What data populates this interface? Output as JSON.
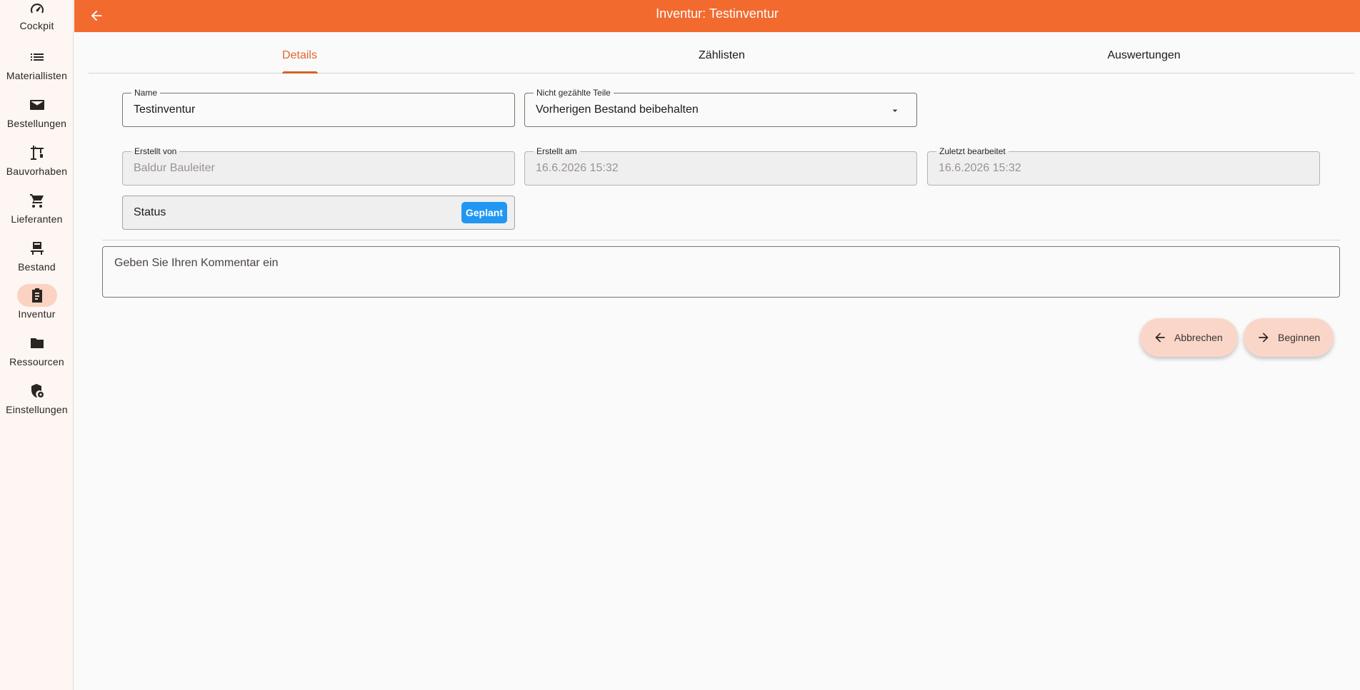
{
  "sidebar": {
    "items": [
      {
        "label": "Cockpit",
        "icon": "speedometer-icon"
      },
      {
        "label": "Materiallisten",
        "icon": "list-icon"
      },
      {
        "label": "Bestellungen",
        "icon": "mail-icon"
      },
      {
        "label": "Bauvorhaben",
        "icon": "crane-icon"
      },
      {
        "label": "Lieferanten",
        "icon": "cart-icon"
      },
      {
        "label": "Bestand",
        "icon": "pallet-icon"
      },
      {
        "label": "Inventur",
        "icon": "clipboard-icon",
        "active": true
      },
      {
        "label": "Ressourcen",
        "icon": "folder-icon"
      },
      {
        "label": "Einstellungen",
        "icon": "shield-gear-icon"
      }
    ]
  },
  "appbar": {
    "title": "Inventur: Testinventur",
    "accent": "#f26a2e"
  },
  "tabs": [
    {
      "label": "Details",
      "active": true
    },
    {
      "label": "Zählisten"
    },
    {
      "label": "Auswertungen"
    }
  ],
  "form": {
    "name": {
      "label": "Name",
      "value": "Testinventur"
    },
    "uncounted": {
      "label": "Nicht gezählte Teile",
      "value": "Vorherigen Bestand beibehalten"
    },
    "created_by": {
      "label": "Erstellt von",
      "value": "Baldur Bauleiter"
    },
    "created_at": {
      "label": "Erstellt am",
      "value": "16.6.2026 15:32"
    },
    "edited_at": {
      "label": "Zuletzt bearbeitet",
      "value": "16.6.2026 15:32"
    },
    "status": {
      "label": "Status",
      "badge": "Geplant",
      "badge_color": "#2196f3"
    },
    "comment_placeholder": "Geben Sie Ihren Kommentar ein"
  },
  "actions": {
    "cancel": "Abbrechen",
    "start": "Beginnen"
  }
}
